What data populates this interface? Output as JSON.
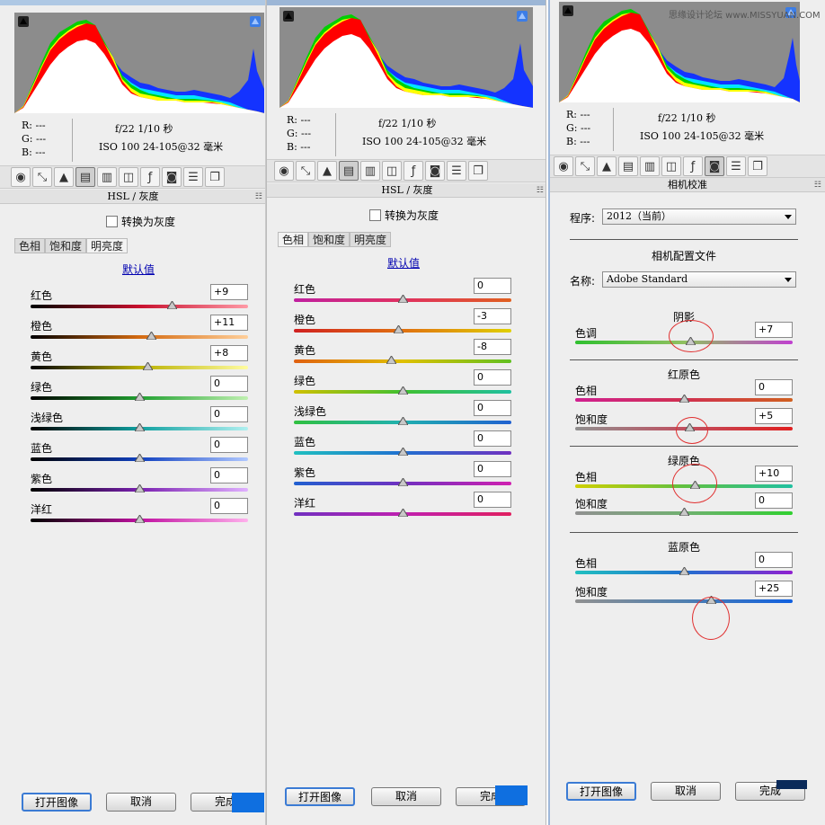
{
  "watermark": "思缘设计论坛 www.MISSYUAN.COM",
  "info": {
    "r": "R:  ---",
    "g": "G:  ---",
    "b": "B:  ---",
    "exposure": "f/22   1/10 秒",
    "lens": "ISO 100   24-105@32 毫米"
  },
  "panel1": {
    "title": "HSL / 灰度",
    "grayscale_label": "转换为灰度",
    "tabs": [
      "色相",
      "饱和度",
      "明亮度"
    ],
    "default_link": "默认值",
    "sliders": [
      {
        "label": "红色",
        "value": "+9",
        "gradient": "linear-gradient(90deg,#000,#c8102e,#ff9aa6)",
        "pos": 0.65
      },
      {
        "label": "橙色",
        "value": "+11",
        "gradient": "linear-gradient(90deg,#000,#d46a10,#ffcf9a)",
        "pos": 0.555
      },
      {
        "label": "黄色",
        "value": "+8",
        "gradient": "linear-gradient(90deg,#000,#b9b000,#fffca0)",
        "pos": 0.54
      },
      {
        "label": "绿色",
        "value": "0",
        "gradient": "linear-gradient(90deg,#000,#20a030,#bff0b0)",
        "pos": 0.5
      },
      {
        "label": "浅绿色",
        "value": "0",
        "gradient": "linear-gradient(90deg,#000,#10a0a0,#b0f0f0)",
        "pos": 0.5
      },
      {
        "label": "蓝色",
        "value": "0",
        "gradient": "linear-gradient(90deg,#000,#1040c0,#b0c8ff)",
        "pos": 0.5
      },
      {
        "label": "紫色",
        "value": "0",
        "gradient": "linear-gradient(90deg,#000,#7a20b0,#e0b0ff)",
        "pos": 0.5
      },
      {
        "label": "洋红",
        "value": "0",
        "gradient": "linear-gradient(90deg,#000,#c010a0,#ffb0ec)",
        "pos": 0.5
      }
    ],
    "buttons": {
      "open": "打开图像",
      "cancel": "取消",
      "done": "完成"
    }
  },
  "panel2": {
    "title": "HSL / 灰度",
    "grayscale_label": "转换为灰度",
    "tabs": [
      "色相",
      "饱和度",
      "明亮度"
    ],
    "default_link": "默认值",
    "sliders": [
      {
        "label": "红色",
        "value": "0",
        "gradient": "linear-gradient(90deg,#c020a0,#e03060,#e06020)",
        "pos": 0.5
      },
      {
        "label": "橙色",
        "value": "-3",
        "gradient": "linear-gradient(90deg,#d02020,#e07010,#e0d000)",
        "pos": 0.48
      },
      {
        "label": "黄色",
        "value": "-8",
        "gradient": "linear-gradient(90deg,#e06010,#e0c000,#60c020)",
        "pos": 0.45
      },
      {
        "label": "绿色",
        "value": "0",
        "gradient": "linear-gradient(90deg,#d0c000,#40c030,#20c0a0)",
        "pos": 0.5
      },
      {
        "label": "浅绿色",
        "value": "0",
        "gradient": "linear-gradient(90deg,#30c040,#20b0b0,#2060d0)",
        "pos": 0.5
      },
      {
        "label": "蓝色",
        "value": "0",
        "gradient": "linear-gradient(90deg,#20c0c0,#2070d0,#7030c0)",
        "pos": 0.5
      },
      {
        "label": "紫色",
        "value": "0",
        "gradient": "linear-gradient(90deg,#2060d0,#7030c0,#d020b0)",
        "pos": 0.5
      },
      {
        "label": "洋红",
        "value": "0",
        "gradient": "linear-gradient(90deg,#7030c0,#c020b0,#e02060)",
        "pos": 0.5
      }
    ],
    "buttons": {
      "open": "打开图像",
      "cancel": "取消",
      "done": "完成"
    }
  },
  "panel3": {
    "title": "相机校准",
    "process_label": "程序:",
    "process_value": "2012（当前）",
    "profile_header": "相机配置文件",
    "name_label": "名称:",
    "name_value": "Adobe Standard",
    "sections": [
      {
        "title": "阴影",
        "sliders": [
          {
            "label": "色调",
            "value": "+7",
            "gradient": "linear-gradient(90deg,#30c030,#90c060,#c040d0)",
            "pos": 0.53
          }
        ]
      },
      {
        "title": "红原色",
        "sliders": [
          {
            "label": "色相",
            "value": "0",
            "gradient": "linear-gradient(90deg,#d02090,#d03050,#d06020)",
            "pos": 0.5
          },
          {
            "label": "饱和度",
            "value": "+5",
            "gradient": "linear-gradient(90deg,#909090,#c05060,#e02020)",
            "pos": 0.525
          }
        ]
      },
      {
        "title": "绿原色",
        "sliders": [
          {
            "label": "色相",
            "value": "+10",
            "gradient": "linear-gradient(90deg,#d0d000,#60c040,#20c0a0)",
            "pos": 0.55
          }
        ]
      },
      {
        "title": "",
        "sliders": [
          {
            "label": "饱和度",
            "value": "0",
            "gradient": "linear-gradient(90deg,#909090,#70b070,#30d030)",
            "pos": 0.5
          }
        ]
      },
      {
        "title": "蓝原色",
        "sliders": [
          {
            "label": "色相",
            "value": "0",
            "gradient": "linear-gradient(90deg,#20c0c0,#2070d0,#9020d0)",
            "pos": 0.5
          },
          {
            "label": "饱和度",
            "value": "+25",
            "gradient": "linear-gradient(90deg,#909090,#5080b0,#1060e0)",
            "pos": 0.625
          }
        ]
      }
    ],
    "buttons": {
      "open": "打开图像",
      "cancel": "取消",
      "done": "完成"
    }
  },
  "colors": {
    "link": "#0000b0",
    "accent": "#3b7bd4",
    "annotation": "#e03030"
  }
}
